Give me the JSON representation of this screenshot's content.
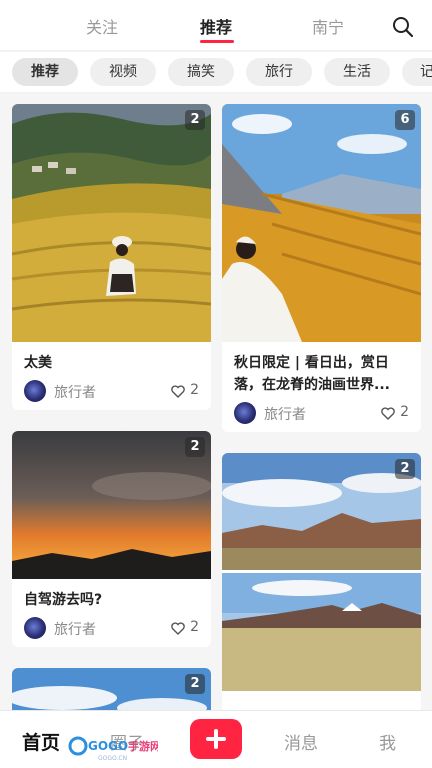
{
  "top_tabs": [
    {
      "label": "关注",
      "active": false
    },
    {
      "label": "推荐",
      "active": true
    },
    {
      "label": "南宁",
      "active": false
    }
  ],
  "search_icon": "search-icon",
  "categories": [
    "推荐",
    "视频",
    "搞笑",
    "旅行",
    "生活",
    "记"
  ],
  "active_category": "推荐",
  "posts": [
    {
      "badge": "2",
      "title": "太美",
      "author": "旅行者",
      "likes": "2"
    },
    {
      "badge": "6",
      "title": "秋日限定 | 看日出，赏日落，在龙脊的油画世界...",
      "author": "旅行者",
      "likes": "2"
    },
    {
      "badge": "2",
      "title": "自驾游去吗?",
      "author": "旅行者",
      "likes": "2"
    },
    {
      "badge": "2",
      "title": "",
      "author": "",
      "likes": ""
    },
    {
      "badge": "2",
      "title": "",
      "author": "",
      "likes": ""
    }
  ],
  "bottom_nav": {
    "home": "首页",
    "circle": "圈子",
    "post_icon": "plus-icon",
    "messages": "消息",
    "me": "我"
  },
  "watermark": {
    "text": "GOGO手游网",
    "sub": "GOGO.CN"
  },
  "colors": {
    "accent": "#ff2442",
    "muted": "#999999",
    "text": "#222222"
  }
}
